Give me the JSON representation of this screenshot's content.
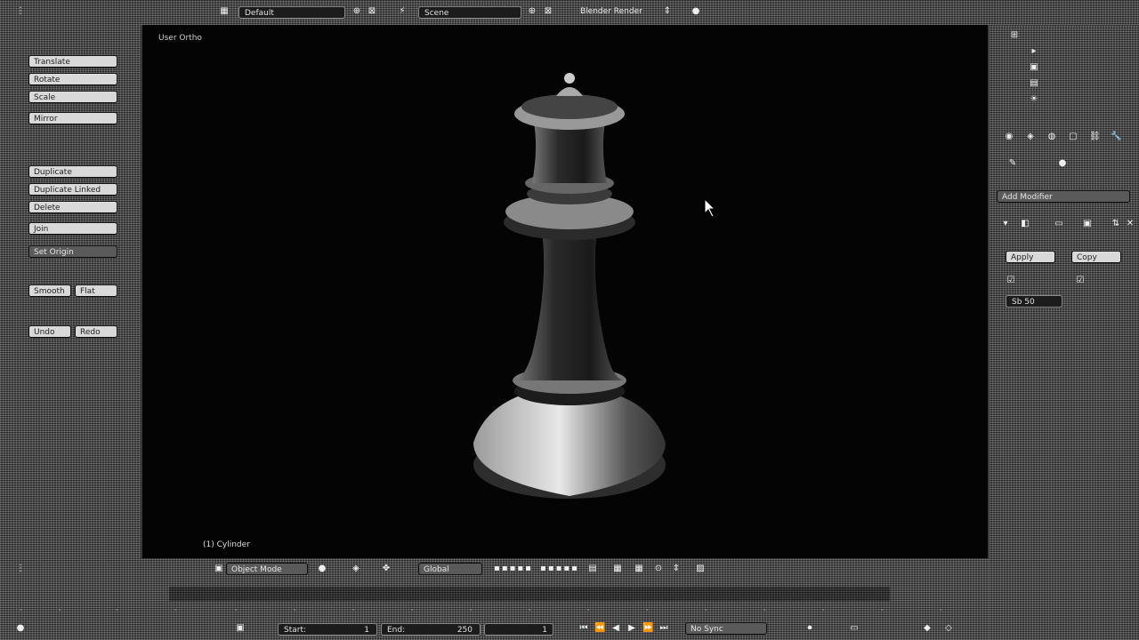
{
  "top_bar": {
    "screen_layout": "Default",
    "scene": "Scene",
    "render_engine": "Blender Render"
  },
  "tool_shelf": {
    "transform_buttons": [
      "Translate",
      "Rotate",
      "Scale"
    ],
    "mirror_button": "Mirror",
    "edit_buttons": [
      "Duplicate",
      "Duplicate Linked",
      "Delete"
    ],
    "join_button": "Join",
    "set_origin": "Set Origin",
    "shading_buttons": [
      "Smooth",
      "Flat"
    ],
    "history_buttons": [
      "Undo",
      "Redo"
    ]
  },
  "viewport": {
    "view_label": "User Ortho",
    "object_label": "(1) Cylinder"
  },
  "viewport_header": {
    "mode": "Object Mode",
    "pivot": "Global"
  },
  "properties": {
    "add_modifier": "Add Modifier",
    "apply_button": "Apply",
    "copy_button": "Copy",
    "checkbox_a": "",
    "checkbox_b": "",
    "subdiv_field": "Sb 50"
  },
  "timeline_header": {
    "start_label": "Start:",
    "start_value": "1",
    "end_label": "End:",
    "end_value": "250",
    "current_frame": "1",
    "sync": "No Sync"
  }
}
